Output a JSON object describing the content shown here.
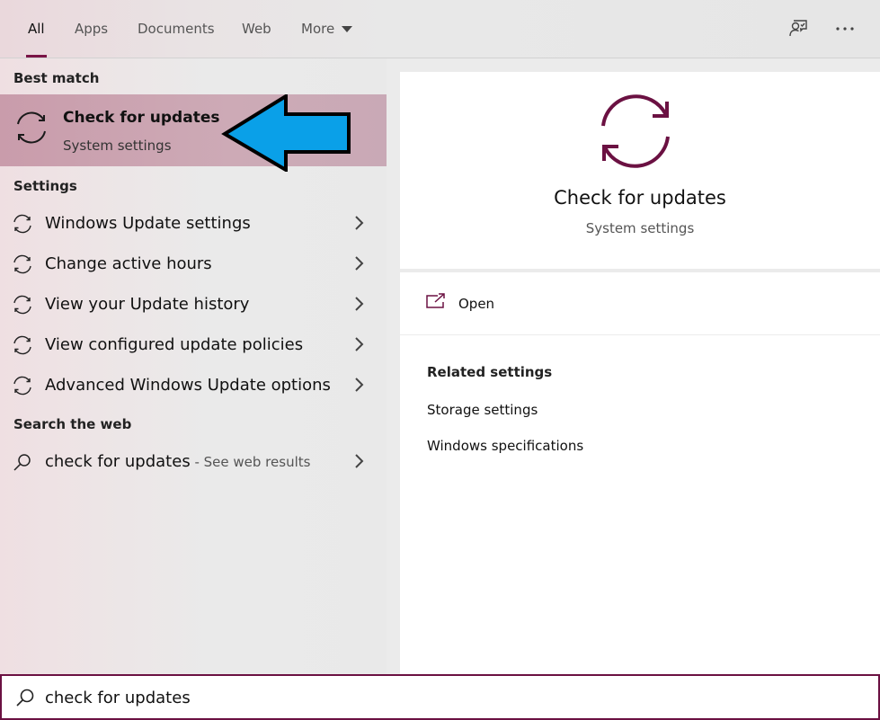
{
  "tabs": [
    {
      "label": "All",
      "active": true
    },
    {
      "label": "Apps",
      "active": false
    },
    {
      "label": "Documents",
      "active": false
    },
    {
      "label": "Web",
      "active": false
    },
    {
      "label": "More",
      "active": false
    }
  ],
  "top_icons": [
    "feedback-icon",
    "more-options-icon"
  ],
  "sections": {
    "best_match": "Best match",
    "settings": "Settings",
    "search_web": "Search the web"
  },
  "best_match": {
    "title": "Check for updates",
    "subtitle": "System settings",
    "icon": "sync-icon"
  },
  "settings_items": [
    {
      "label": "Windows Update settings"
    },
    {
      "label": "Change active hours"
    },
    {
      "label": "View your Update history"
    },
    {
      "label": "View configured update policies"
    },
    {
      "label": "Advanced Windows Update options"
    }
  ],
  "web_result": {
    "query": "check for updates",
    "suffix": " - See web results"
  },
  "preview": {
    "title": "Check for updates",
    "subtitle": "System settings",
    "open_label": "Open",
    "related_heading": "Related settings",
    "related": [
      "Storage settings",
      "Windows specifications"
    ]
  },
  "search": {
    "value": "check for updates"
  },
  "colors": {
    "accent": "#7a1446",
    "highlight": "#c99cab",
    "arrow_fill": "#0aa0e8"
  }
}
